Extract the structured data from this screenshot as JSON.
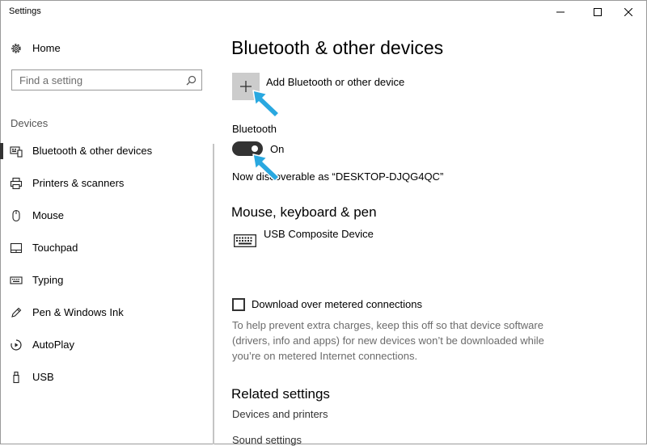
{
  "window": {
    "title": "Settings",
    "controls": {
      "minimize_icon": "minimize-icon",
      "maximize_icon": "maximize-icon",
      "close_icon": "close-icon"
    }
  },
  "sidebar": {
    "home": {
      "label": "Home",
      "icon": "gear-icon"
    },
    "search": {
      "placeholder": "Find a setting",
      "value": "",
      "icon": "search-icon"
    },
    "section": "Devices",
    "items": [
      {
        "label": "Bluetooth & other devices",
        "icon": "bluetooth-devices-icon",
        "selected": true
      },
      {
        "label": "Printers & scanners",
        "icon": "printer-icon"
      },
      {
        "label": "Mouse",
        "icon": "mouse-icon"
      },
      {
        "label": "Touchpad",
        "icon": "touchpad-icon"
      },
      {
        "label": "Typing",
        "icon": "keyboard-icon"
      },
      {
        "label": "Pen & Windows Ink",
        "icon": "pen-icon"
      },
      {
        "label": "AutoPlay",
        "icon": "autoplay-icon"
      },
      {
        "label": "USB",
        "icon": "usb-icon"
      }
    ]
  },
  "main": {
    "title": "Bluetooth & other devices",
    "add_device": {
      "label": "Add Bluetooth or other device",
      "icon": "plus-icon"
    },
    "bluetooth": {
      "label": "Bluetooth",
      "toggle_state": "On",
      "on": true
    },
    "discoverable_text": "Now discoverable as “DESKTOP-DJQG4QC”",
    "mouse_section": {
      "title": "Mouse, keyboard & pen",
      "devices": [
        {
          "label": "USB Composite Device",
          "icon": "keyboard-icon"
        }
      ]
    },
    "metered": {
      "label": "Download over metered connections",
      "checked": false,
      "help": "To help prevent extra charges, keep this off so that device software (drivers, info and apps) for new devices won’t be downloaded while you’re on metered Internet connections."
    },
    "related": {
      "title": "Related settings",
      "links": [
        "Devices and printers",
        "Sound settings"
      ]
    }
  },
  "annotations": {
    "pointer_color": "#29a8e0",
    "pointer_icon": "arrow-pointer-icon"
  },
  "colors": {
    "toggle_on": "#333333",
    "add_button_bg": "#cccccc",
    "selected_bar": "#333333"
  }
}
